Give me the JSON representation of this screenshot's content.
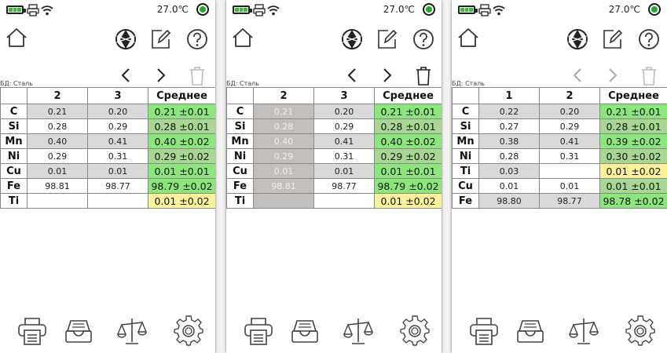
{
  "screens": [
    {
      "temperature": "27.0℃",
      "db_label": "БД: Сталь",
      "headers": [
        "",
        "2",
        "3",
        "Среднее"
      ],
      "rows": [
        {
          "el": "C",
          "a": "0.21",
          "b": "0.20",
          "avg": "0.21 ±0.01"
        },
        {
          "el": "Si",
          "a": "0.28",
          "b": "0.29",
          "avg": "0.28 ±0.01"
        },
        {
          "el": "Mn",
          "a": "0.40",
          "b": "0.41",
          "avg": "0.40 ±0.02"
        },
        {
          "el": "Ni",
          "a": "0.29",
          "b": "0.31",
          "avg": "0.29 ±0.02"
        },
        {
          "el": "Cu",
          "a": "0.01",
          "b": "0.01",
          "avg": "0.01 ±0.01"
        },
        {
          "el": "Fe",
          "a": "98.81",
          "b": "98.77",
          "avg": "98.79 ±0.02"
        },
        {
          "el": "Ti",
          "a": "",
          "b": "",
          "avg": "0.01 ±0.02"
        }
      ]
    },
    {
      "temperature": "27.0℃",
      "db_label": "БД: Сталь",
      "headers": [
        "",
        "2",
        "3",
        "Среднее"
      ],
      "rows": [
        {
          "el": "C",
          "a": "0.21",
          "b": "0.20",
          "avg": "0.21 ±0.01"
        },
        {
          "el": "Si",
          "a": "0.28",
          "b": "0.29",
          "avg": "0.28 ±0.01"
        },
        {
          "el": "Mn",
          "a": "0.40",
          "b": "0.41",
          "avg": "0.40 ±0.02"
        },
        {
          "el": "Ni",
          "a": "0.29",
          "b": "0.31",
          "avg": "0.29 ±0.02"
        },
        {
          "el": "Cu",
          "a": "0.01",
          "b": "0.01",
          "avg": "0.01 ±0.01"
        },
        {
          "el": "Fe",
          "a": "98.81",
          "b": "98.77",
          "avg": "98.79 ±0.02"
        },
        {
          "el": "Ti",
          "a": "",
          "b": "",
          "avg": "0.01 ±0.02"
        }
      ]
    },
    {
      "temperature": "27.0℃",
      "db_label": "БД: Сталь",
      "headers": [
        "",
        "1",
        "2",
        "Среднее"
      ],
      "rows": [
        {
          "el": "C",
          "a": "0.22",
          "b": "0.20",
          "avg": "0.21 ±0.01"
        },
        {
          "el": "Si",
          "a": "0.27",
          "b": "0.29",
          "avg": "0.28 ±0.01"
        },
        {
          "el": "Mn",
          "a": "0.38",
          "b": "0.41",
          "avg": "0.39 ±0.02"
        },
        {
          "el": "Ni",
          "a": "0.28",
          "b": "0.31",
          "avg": "0.30 ±0.02"
        },
        {
          "el": "Ti",
          "a": "0.03",
          "b": "",
          "avg": "0.01 ±0.02"
        },
        {
          "el": "Cu",
          "a": "0.01",
          "b": "0.01",
          "avg": "0.01 ±0.01"
        },
        {
          "el": "Fe",
          "a": "98.80",
          "b": "98.77",
          "avg": "98.78 ±0.02"
        }
      ]
    }
  ],
  "colors": {
    "battery": "#2ec42e",
    "status_dot": "#1faa2f",
    "avg_green": "#8be67b",
    "avg_green_dim": "#a7d792",
    "avg_yellow": "#fdf19a",
    "row_gray": "#d9d9d9",
    "excluded": "#c4bfbb"
  },
  "icons": [
    "battery-icon",
    "printer-icon",
    "wifi-icon",
    "status-dot",
    "home-icon",
    "shutter-icon",
    "edit-icon",
    "help-icon",
    "chevron-left-icon",
    "chevron-right-icon",
    "trash-icon",
    "archive-icon",
    "scales-icon",
    "settings-icon"
  ]
}
